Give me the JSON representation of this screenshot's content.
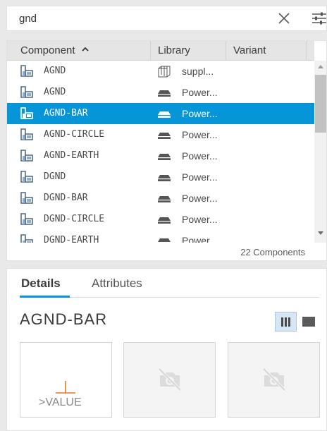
{
  "search": {
    "value": "gnd",
    "clear_icon": "close-icon",
    "filter_icon": "filter-sliders-icon"
  },
  "table": {
    "columns": [
      "Component",
      "Library",
      "Variant"
    ],
    "sort_icon": "chevron-up-icon",
    "rows": [
      {
        "component": "AGND",
        "library": "suppl...",
        "library_icon": "library-book-icon",
        "selected": false
      },
      {
        "component": "AGND",
        "library": "Power...",
        "library_icon": "library-drive-icon",
        "selected": false
      },
      {
        "component": "AGND-BAR",
        "library": "Power...",
        "library_icon": "library-drive-icon",
        "selected": true
      },
      {
        "component": "AGND-CIRCLE",
        "library": "Power...",
        "library_icon": "library-drive-icon",
        "selected": false
      },
      {
        "component": "AGND-EARTH",
        "library": "Power...",
        "library_icon": "library-drive-icon",
        "selected": false
      },
      {
        "component": "DGND",
        "library": "Power...",
        "library_icon": "library-drive-icon",
        "selected": false
      },
      {
        "component": "DGND-BAR",
        "library": "Power...",
        "library_icon": "library-drive-icon",
        "selected": false
      },
      {
        "component": "DGND-CIRCLE",
        "library": "Power...",
        "library_icon": "library-drive-icon",
        "selected": false
      },
      {
        "component": "DGND-EARTH",
        "library": "Power...",
        "library_icon": "library-drive-icon",
        "selected": false
      }
    ],
    "count_label": "22 Components"
  },
  "details": {
    "tabs": [
      "Details",
      "Attributes"
    ],
    "active_tab": "Details",
    "component_title": "AGND-BAR",
    "previews": [
      {
        "kind": "symbol",
        "label": ">VALUE"
      },
      {
        "kind": "no-image",
        "icon": "camera-off-icon"
      },
      {
        "kind": "no-image",
        "icon": "camera-off-icon"
      }
    ]
  },
  "colors": {
    "accent": "#0696d7",
    "symbol": "#e87722",
    "component_icon": "#5a6f86",
    "component_icon_accent": "#8fb0cf"
  }
}
